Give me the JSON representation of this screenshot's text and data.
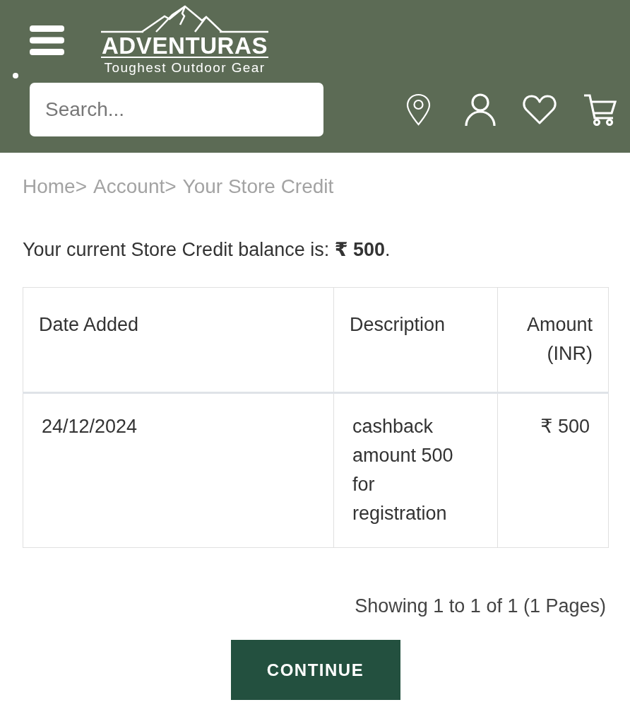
{
  "header": {
    "logo": {
      "name": "ADVENTURAS",
      "tagline": "Toughest Outdoor Gear"
    },
    "search": {
      "placeholder": "Search..."
    }
  },
  "breadcrumb": [
    {
      "label": "Home",
      "separator": ">"
    },
    {
      "label": "Account",
      "separator": ">"
    },
    {
      "label": "Your Store Credit"
    }
  ],
  "balance": {
    "text": "Your current Store Credit balance is: **₹ 500**."
  },
  "table": {
    "columns": [
      {
        "label": "Date Added",
        "kind": "text"
      },
      {
        "label": "Description",
        "kind": "text"
      },
      {
        "label": "Amount (INR)",
        "kind": "amount"
      }
    ],
    "rows": [
      {
        "cells": [
          "24/12/2024",
          "cashback amount 500 for registration",
          "₹ 500"
        ]
      }
    ]
  },
  "pagination": {
    "summary": "Showing 1 to 1 of 1 (1 Pages)"
  },
  "buttons": [
    {
      "label": "CONTINUE"
    }
  ]
}
